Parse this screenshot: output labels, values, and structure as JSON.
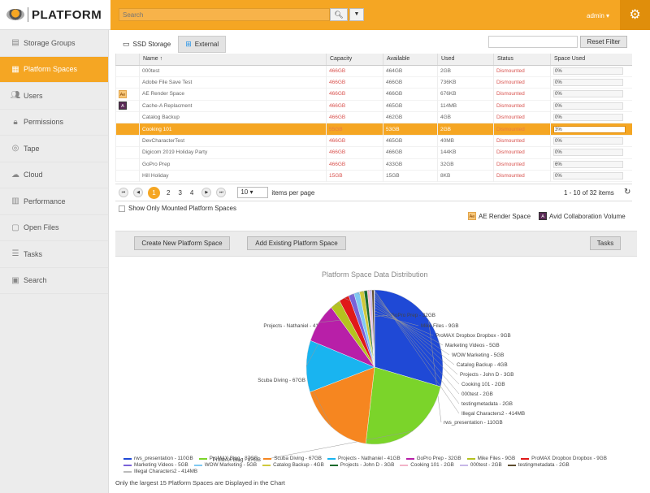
{
  "app": {
    "logo_text": "PLATFORM",
    "search_placeholder": "Search",
    "user": "admin ▾"
  },
  "sidebar": {
    "items": [
      {
        "label": "Storage Groups",
        "icon": "storage-icon"
      },
      {
        "label": "Platform Spaces",
        "icon": "platform-spaces-icon",
        "active": true
      },
      {
        "label": "Users",
        "icon": "users-icon"
      },
      {
        "label": "Permissions",
        "icon": "lock-icon"
      },
      {
        "label": "Tape",
        "icon": "tape-icon"
      },
      {
        "label": "Cloud",
        "icon": "cloud-icon"
      },
      {
        "label": "Performance",
        "icon": "chart-icon"
      },
      {
        "label": "Open Files",
        "icon": "file-icon"
      },
      {
        "label": "Tasks",
        "icon": "tasks-icon"
      },
      {
        "label": "Search",
        "icon": "search-icon"
      }
    ]
  },
  "tabs": [
    {
      "label": "SSD Storage"
    },
    {
      "label": "External"
    }
  ],
  "reset_filter": "Reset Filter",
  "table": {
    "columns": [
      "Name ↑",
      "Capacity",
      "Available",
      "Used",
      "Status",
      "Space Used"
    ],
    "rows": [
      {
        "icon": "",
        "name": "000test",
        "capacity": "466GB",
        "available": "464GB",
        "used": "2GB",
        "status": "Dismounted",
        "space_used": "0%"
      },
      {
        "icon": "",
        "name": "Adobe File Save Test",
        "capacity": "466GB",
        "available": "466GB",
        "used": "736KB",
        "status": "Dismounted",
        "space_used": "0%"
      },
      {
        "icon": "ae",
        "name": "AE Render Space",
        "capacity": "466GB",
        "available": "466GB",
        "used": "676KB",
        "status": "Dismounted",
        "space_used": "0%"
      },
      {
        "icon": "avid",
        "name": "Cache-A Replacment",
        "capacity": "466GB",
        "available": "465GB",
        "used": "114MB",
        "status": "Dismounted",
        "space_used": "0%"
      },
      {
        "icon": "",
        "name": "Catalog Backup",
        "capacity": "466GB",
        "available": "462GB",
        "used": "4GB",
        "status": "Dismounted",
        "space_used": "0%"
      },
      {
        "icon": "",
        "name": "Cooking 101",
        "capacity": "55GB",
        "available": "53GB",
        "used": "2GB",
        "status": "Dismounted",
        "space_used": "3%",
        "selected": true
      },
      {
        "icon": "",
        "name": "DevCharacterTest",
        "capacity": "466GB",
        "available": "465GB",
        "used": "40MB",
        "status": "Dismounted",
        "space_used": "0%"
      },
      {
        "icon": "",
        "name": "Digicom 2019 Holiday Party",
        "capacity": "466GB",
        "available": "466GB",
        "used": "144KB",
        "status": "Dismounted",
        "space_used": "0%"
      },
      {
        "icon": "",
        "name": "GoPro Prep",
        "capacity": "466GB",
        "available": "433GB",
        "used": "32GB",
        "status": "Dismounted",
        "space_used": "6%"
      },
      {
        "icon": "",
        "name": "Hill Holiday",
        "capacity": "15GB",
        "available": "15GB",
        "used": "8KB",
        "status": "Dismounted",
        "space_used": "0%"
      }
    ]
  },
  "pager": {
    "pages": [
      "1",
      "2",
      "3",
      "4"
    ],
    "page_size": "10",
    "items_label": "items per page",
    "count": "1 - 10 of 32 items"
  },
  "mounted_label": "Show Only Mounted Platform Spaces",
  "type_legend": [
    {
      "label": "AE Render Space",
      "chip": "Ae"
    },
    {
      "label": "Avid Collaboration Volume",
      "chip": "A"
    }
  ],
  "buttons": {
    "create": "Create New Platform Space",
    "add": "Add Existing Platform Space",
    "tasks": "Tasks"
  },
  "chart_data": {
    "type": "pie",
    "title": "Platform Space Data Distribution",
    "labels": [
      "rws_presentation - 110GB",
      "ProMAX Blog - 87GB",
      "Scuba Diving - 67GB",
      "Projects - Nathaniel - 41GB",
      "GoPro Prep - 32GB",
      "Mike Files - 9GB",
      "ProMAX Dropbox Dropbox - 9GB",
      "Marketing Videos - 5GB",
      "WOW Marketing - 5GB",
      "Catalog Backup - 4GB",
      "Projects - John D - 3GB",
      "Cooking 101 - 2GB",
      "000test - 2GB",
      "testingmetadata - 2GB",
      "Illegal Characters2 - 414MB"
    ],
    "values": [
      110,
      87,
      67,
      41,
      32,
      9,
      9,
      5,
      5,
      4,
      3,
      2,
      2,
      2,
      0.414
    ],
    "colors": [
      "#1f49d6",
      "#7bd42a",
      "#f68620",
      "#19b4f0",
      "#b81fa8",
      "#b5c21f",
      "#e01919",
      "#7a62d8",
      "#7fc9f2",
      "#cfc93c",
      "#1b6b2c",
      "#f2b4c8",
      "#c7b7e8",
      "#5e4d30",
      "#bbbbbb"
    ]
  },
  "footnote": "Only the largest 15 Platform Spaces are Displayed in the Chart"
}
